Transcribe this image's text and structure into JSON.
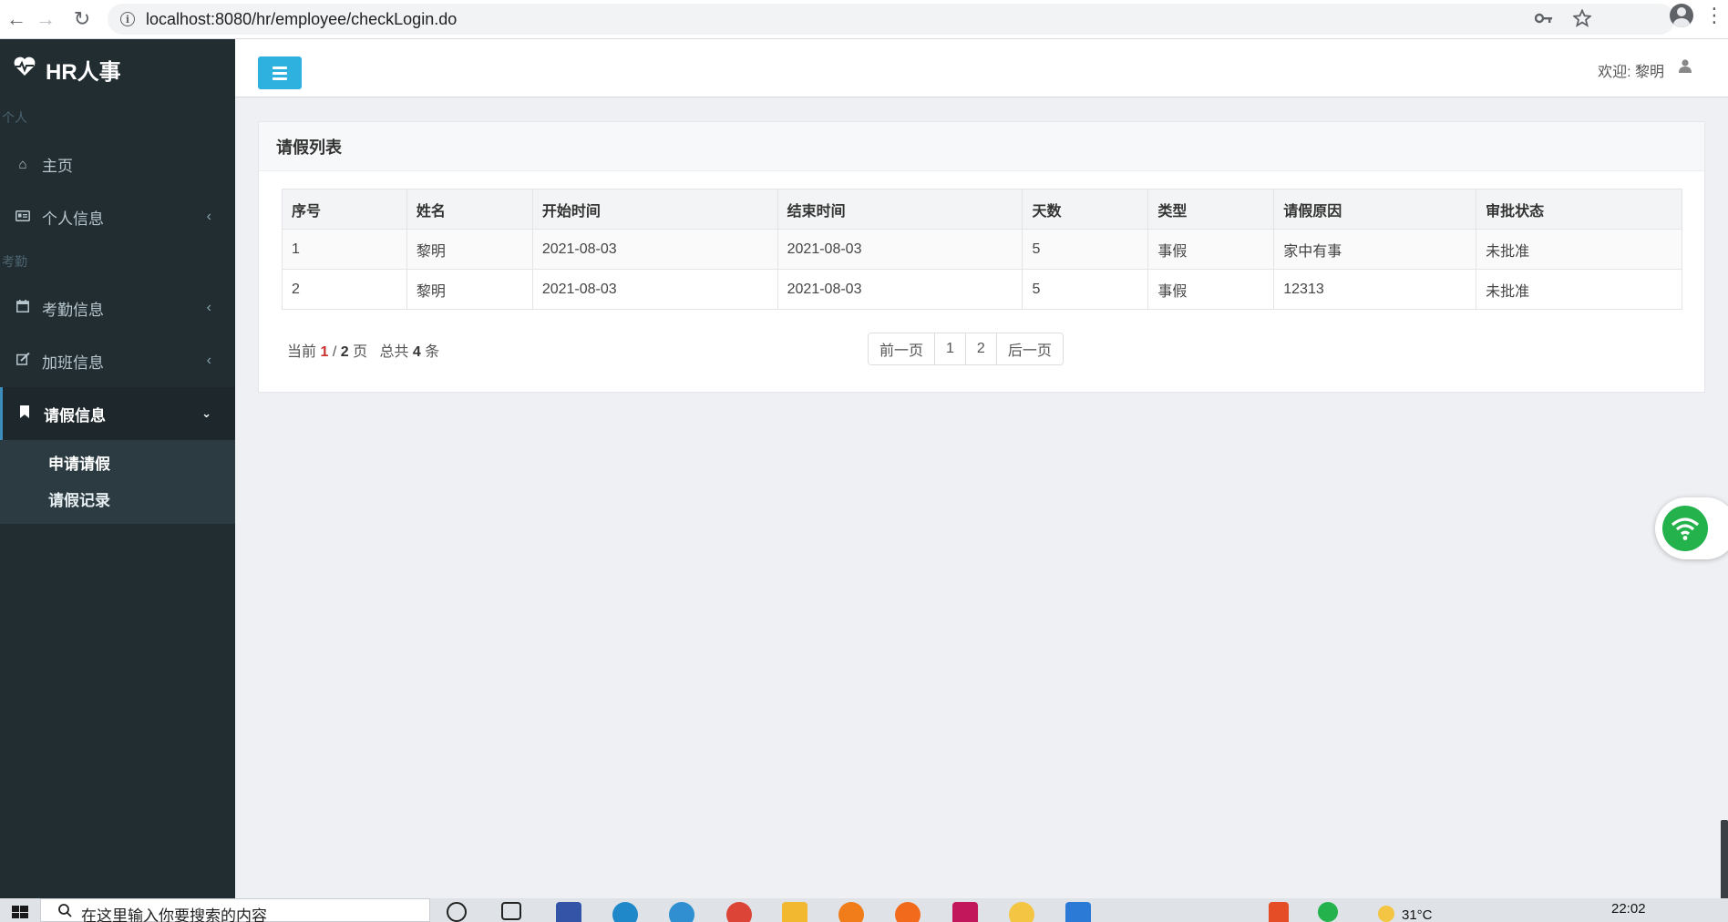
{
  "browser": {
    "url": "localhost:8080/hr/employee/checkLogin.do"
  },
  "sidebar": {
    "logo": "HR人事",
    "sections": [
      {
        "header": "个人"
      },
      {
        "header": "考勤"
      }
    ],
    "items": [
      {
        "label": "主页"
      },
      {
        "label": "个人信息"
      },
      {
        "label": "考勤信息"
      },
      {
        "label": "加班信息"
      },
      {
        "label": "请假信息"
      }
    ],
    "submenu": [
      {
        "label": "申请请假"
      },
      {
        "label": "请假记录"
      }
    ]
  },
  "header": {
    "welcome": "欢迎: 黎明"
  },
  "main": {
    "box_title": "请假列表",
    "table": {
      "columns": [
        "序号",
        "姓名",
        "开始时间",
        "结束时间",
        "天数",
        "类型",
        "请假原因",
        "审批状态"
      ],
      "rows": [
        [
          "1",
          "黎明",
          "2021-08-03",
          "2021-08-03",
          "5",
          "事假",
          "家中有事",
          "未批准"
        ],
        [
          "2",
          "黎明",
          "2021-08-03",
          "2021-08-03",
          "5",
          "事假",
          "12313",
          "未批准"
        ]
      ]
    },
    "page_info": {
      "prefix": "当前",
      "current": "1",
      "sep": "/",
      "total_pages": "2",
      "page_word": "页",
      "total_prefix": "总共",
      "total_count": "4",
      "count_word": "条"
    },
    "pagination": {
      "prev": "前一页",
      "pages": [
        "1",
        "2"
      ],
      "next": "后一页"
    }
  },
  "taskbar": {
    "search_placeholder": "在这里输入你要搜索的内容",
    "temperature": "31°C",
    "time": "22:02"
  },
  "colors": {
    "sidebar_bg": "#222d32",
    "toggle_btn": "#2fb1e0",
    "current_page": "#c9302c",
    "wifi_green": "#23b24b"
  }
}
